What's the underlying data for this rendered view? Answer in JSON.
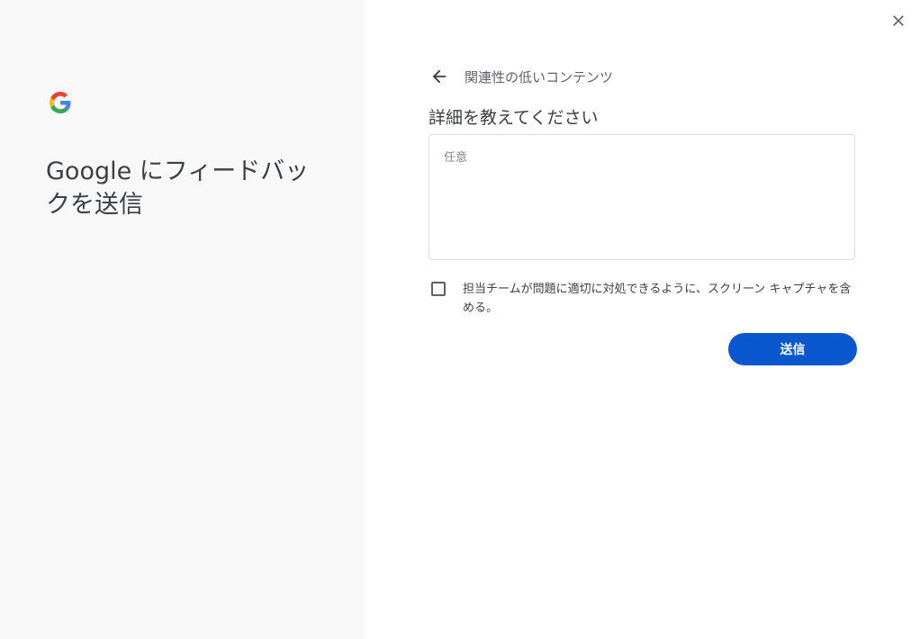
{
  "left": {
    "title": "Google にフィードバックを送信"
  },
  "header": {
    "back_label": "関連性の低いコンテンツ"
  },
  "form": {
    "heading": "詳細を教えてください",
    "details_placeholder": "任意",
    "details_value": "",
    "checkbox_label": "担当チームが問題に適切に対処できるように、スクリーン キャプチャを含める。",
    "checkbox_checked": false,
    "submit_label": "送信"
  },
  "colors": {
    "accent": "#0b57d0",
    "left_panel_bg": "#f8f8f8",
    "text_primary": "#3c4043",
    "text_secondary": "#5f6368",
    "border": "#dadce0"
  },
  "icons": {
    "logo": "google-g-icon",
    "close": "close-icon",
    "back": "arrow-back-icon"
  }
}
